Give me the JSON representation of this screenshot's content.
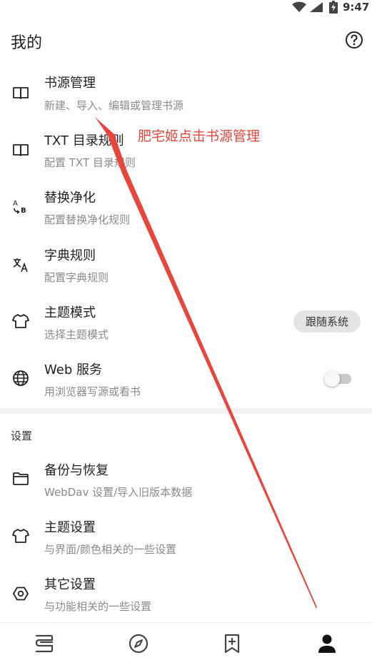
{
  "status_bar": {
    "time": "9:47",
    "icons": [
      "wifi-icon",
      "signal-icon",
      "battery-icon"
    ]
  },
  "app_bar": {
    "title": "我的",
    "help_icon": "help-circle-icon"
  },
  "items": [
    {
      "title": "书源管理",
      "subtitle": "新建、导入、编辑或管理书源",
      "icon": "book-icon"
    },
    {
      "title": "TXT 目录规则",
      "subtitle": "配置 TXT 目录规则",
      "icon": "book-icon"
    },
    {
      "title": "替换净化",
      "subtitle": "配置替换净化规则",
      "icon": "replace-icon"
    },
    {
      "title": "字典规则",
      "subtitle": "配置字典规则",
      "icon": "translate-icon"
    },
    {
      "title": "主题模式",
      "subtitle": "选择主题模式",
      "icon": "shirt-icon",
      "value": "跟随系统"
    },
    {
      "title": "Web 服务",
      "subtitle": "用浏览器写源或看书",
      "icon": "globe-icon",
      "toggle": "off"
    }
  ],
  "settings_section": {
    "header": "设置",
    "items": [
      {
        "title": "备份与恢复",
        "subtitle": "WebDav 设置/导入旧版本数据",
        "icon": "folder-icon"
      },
      {
        "title": "主题设置",
        "subtitle": "与界面/颜色相关的一些设置",
        "icon": "shirt-icon"
      },
      {
        "title": "其它设置",
        "subtitle": "与功能相关的一些设置",
        "icon": "hexagon-settings-icon"
      }
    ]
  },
  "annotation": {
    "text": "肥宅姬点击书源管理",
    "color": "#e8453c"
  },
  "bottom_nav": {
    "items": [
      "bookshelf-icon",
      "compass-icon",
      "bookmark-add-icon",
      "person-icon"
    ],
    "selected": "person-icon"
  }
}
